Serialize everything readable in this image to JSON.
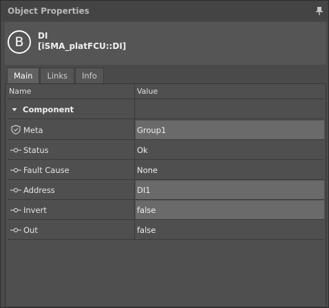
{
  "panel": {
    "title": "Object Properties"
  },
  "object": {
    "icon_letter": "B",
    "name": "DI",
    "type": "[iSMA_platFCU::DI]"
  },
  "tabs": [
    {
      "label": "Main",
      "active": true
    },
    {
      "label": "Links",
      "active": false
    },
    {
      "label": "Info",
      "active": false
    }
  ],
  "grid": {
    "col_name": "Name",
    "col_value": "Value",
    "section": "Component",
    "rows": [
      {
        "icon": "shield-icon",
        "label": "Meta",
        "value": "Group1",
        "editable": true
      },
      {
        "icon": "slot-icon",
        "label": "Status",
        "value": "Ok",
        "editable": false
      },
      {
        "icon": "slot-icon",
        "label": "Fault Cause",
        "value": "None",
        "editable": false
      },
      {
        "icon": "slot-icon",
        "label": "Address",
        "value": "DI1",
        "editable": true
      },
      {
        "icon": "slot-icon",
        "label": "Invert",
        "value": "false",
        "editable": true
      },
      {
        "icon": "slot-icon",
        "label": "Out",
        "value": "false",
        "editable": false
      }
    ]
  }
}
